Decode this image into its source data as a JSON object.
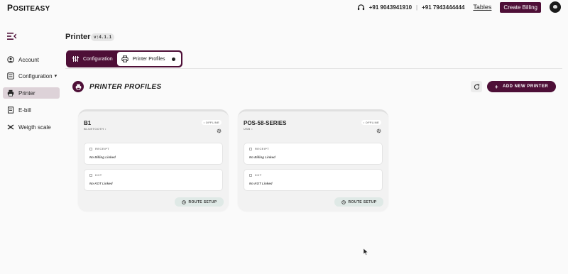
{
  "app": {
    "logo": "OSITEASY",
    "phone1": "+91 9043941910",
    "phone2": "+91 7943444444",
    "tables": "Tables",
    "create_billing": "Create Billing"
  },
  "sidebar": {
    "items": [
      {
        "label": "Account",
        "icon": "account-icon"
      },
      {
        "label": "Configuration",
        "icon": "configuration-icon"
      },
      {
        "label": "Printer",
        "icon": "printer-icon"
      },
      {
        "label": "E-bill",
        "icon": "ebill-icon"
      },
      {
        "label": "Weigth scale",
        "icon": "scale-icon"
      }
    ]
  },
  "header": {
    "title": "Printer",
    "version": "v:4.1.1"
  },
  "tabs": [
    {
      "label": "Configuration"
    },
    {
      "label": "Printer Profiles"
    }
  ],
  "section": {
    "title": "PRINTER PROFILES",
    "add_label": "ADD NEW PRINTER"
  },
  "printers": [
    {
      "name": "B1",
      "connection": "BLUETOOTH",
      "status": "OFFLINE",
      "receipt_label": "RECEIPT",
      "receipt_value": "No Billing Linked",
      "kot_label": "KOT",
      "kot_value": "No KOT Linked",
      "route_label": "ROUTE SETUP"
    },
    {
      "name": "POS-58-SERIES",
      "connection": "USB",
      "status": "OFFLINE",
      "receipt_label": "RECEIPT",
      "receipt_value": "No Billing Linked",
      "kot_label": "KOT",
      "kot_value": "No KOT Linked",
      "route_label": "ROUTE SETUP"
    }
  ],
  "colors": {
    "brand": "#4e0f37",
    "active_side": "#ddd2d8",
    "route_btn": "#dfe9e6"
  }
}
